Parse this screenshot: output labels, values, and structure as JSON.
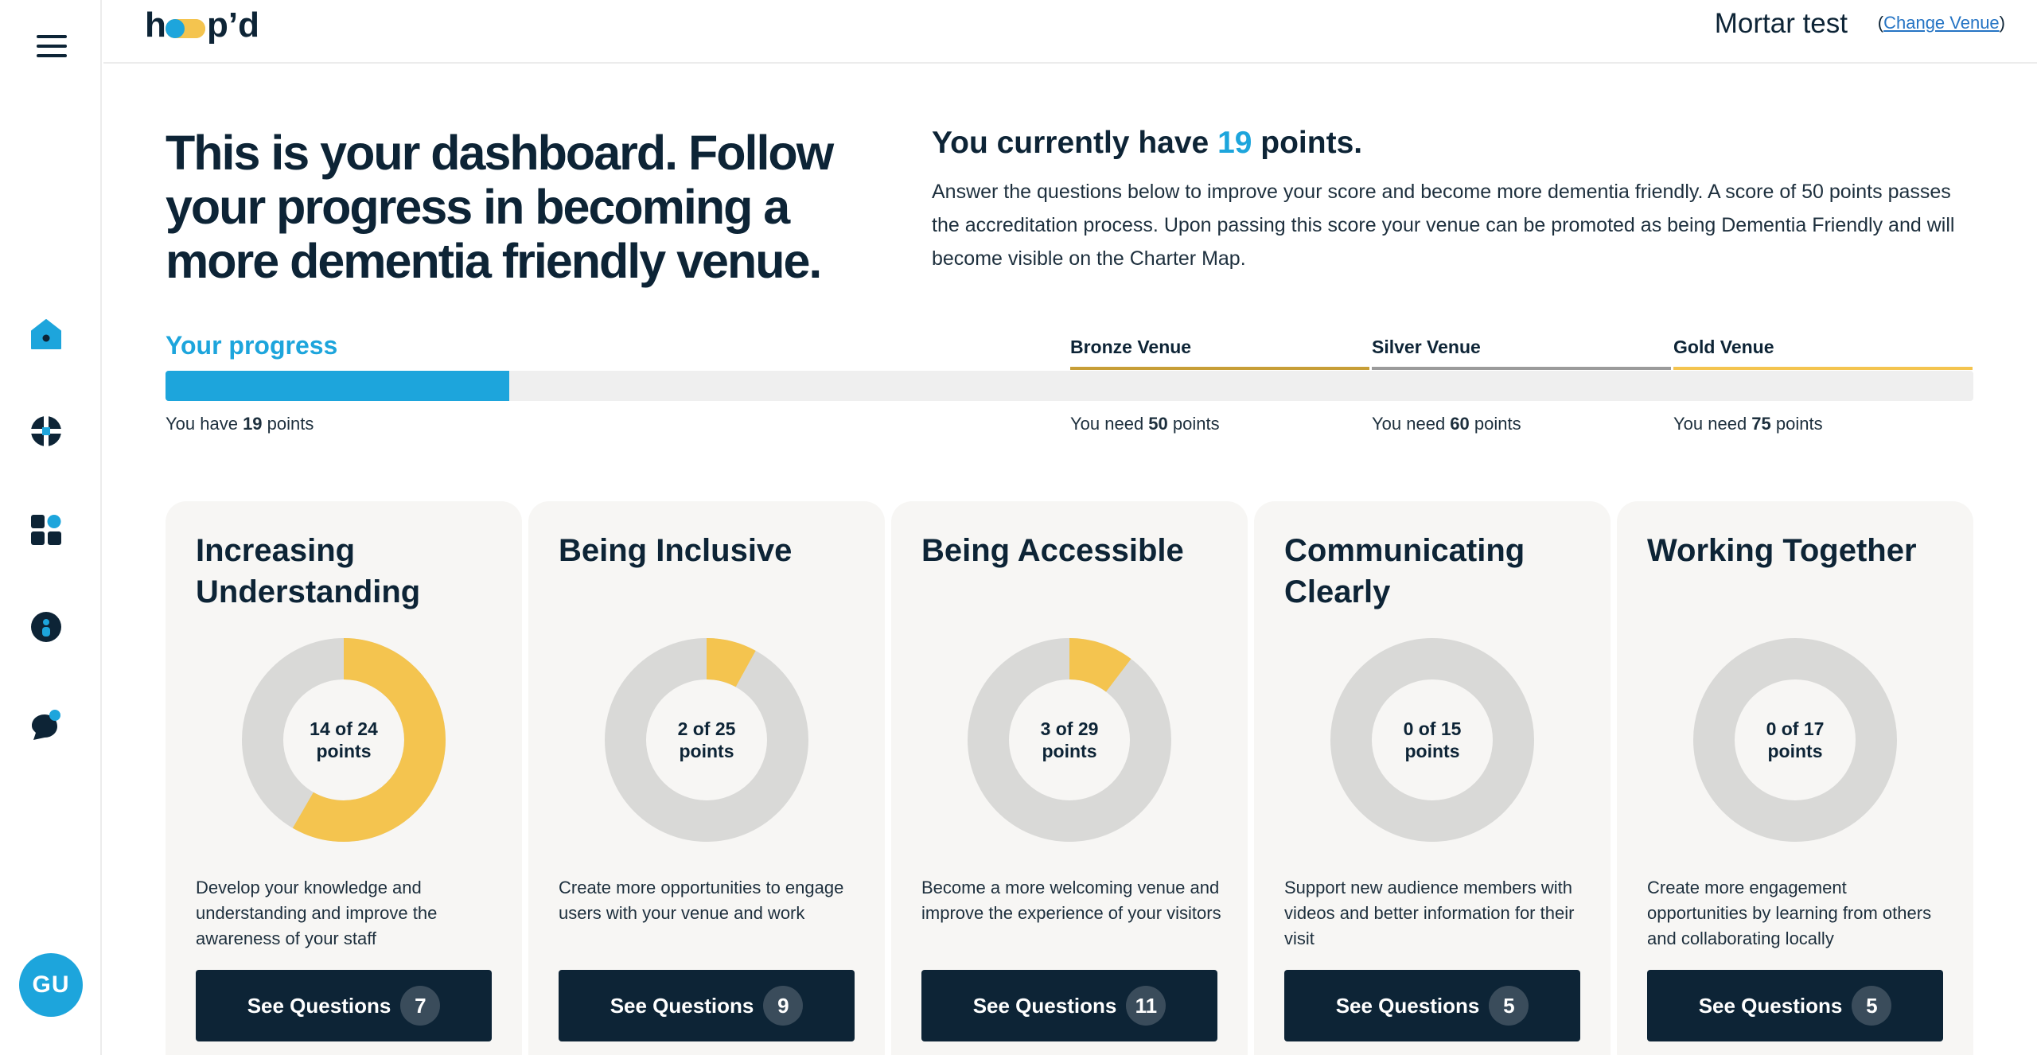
{
  "app": {
    "logo_text": "hoop'd",
    "colors": {
      "accent": "#1da5dc",
      "navy": "#0d2436",
      "yellow": "#f4c44f",
      "bronze": "#c79e37",
      "silver": "#9b9b9b",
      "gold": "#f4c44f",
      "track": "#d9d9d7"
    }
  },
  "sidebar": {
    "menu_icon": "hamburger-icon",
    "items": [
      {
        "icon": "home-icon"
      },
      {
        "icon": "resources-icon"
      },
      {
        "icon": "dashboard-grid-icon"
      },
      {
        "icon": "profile-icon"
      },
      {
        "icon": "chat-icon"
      }
    ],
    "avatar": "GU"
  },
  "header": {
    "venue_name": "Mortar test",
    "change_open": "(",
    "change_link": "Change Venue",
    "change_close": ")"
  },
  "intro": {
    "title": "This is your dashboard. Follow your progress in becoming a more dementia friendly venue.",
    "points_prefix": "You currently have ",
    "points_value": "19",
    "points_suffix": " points.",
    "description": "Answer the questions below to improve your score and become more dementia friendly. A score of 50 points passes the accreditation process. Upon passing this score your venue can be promoted as being Dementia Friendly and will become visible on the Charter Map."
  },
  "progress": {
    "label": "Your progress",
    "current": 19,
    "fill_fraction": 0.19,
    "you_have_prefix": "You have ",
    "you_have_value": "19",
    "you_have_suffix": " points",
    "tiers": [
      {
        "name": "Bronze Venue",
        "need_prefix": "You need ",
        "need_value": "50",
        "need_suffix": " points",
        "color": "#c79e37"
      },
      {
        "name": "Silver Venue",
        "need_prefix": "You need ",
        "need_value": "60",
        "need_suffix": " points",
        "color": "#9b9b9b"
      },
      {
        "name": "Gold Venue",
        "need_prefix": "You need ",
        "need_value": "75",
        "need_suffix": " points",
        "color": "#f4c44f"
      }
    ]
  },
  "cards": [
    {
      "title": "Increasing Understanding",
      "score": 14,
      "total": 24,
      "label_top": "14 of 24",
      "label_bottom": "points",
      "description": "Develop your knowledge and understanding and improve the awareness of your staff",
      "button": "See Questions",
      "count": "7"
    },
    {
      "title": "Being Inclusive",
      "score": 2,
      "total": 25,
      "label_top": "2 of 25",
      "label_bottom": "points",
      "description": "Create more opportunities to engage users with your venue and work",
      "button": "See Questions",
      "count": "9"
    },
    {
      "title": "Being Accessible",
      "score": 3,
      "total": 29,
      "label_top": "3 of 29",
      "label_bottom": "points",
      "description": "Become a more welcoming venue and improve the experience of your visitors",
      "button": "See Questions",
      "count": "11"
    },
    {
      "title": "Communicating Clearly",
      "score": 0,
      "total": 15,
      "label_top": "0 of 15",
      "label_bottom": "points",
      "description": "Support new audience members with videos and better information for their visit",
      "button": "See Questions",
      "count": "5"
    },
    {
      "title": "Working Together",
      "score": 0,
      "total": 17,
      "label_top": "0 of 17",
      "label_bottom": "points",
      "description": "Create more engagement opportunities by learning from others and collaborating locally",
      "button": "See Questions",
      "count": "5"
    }
  ]
}
